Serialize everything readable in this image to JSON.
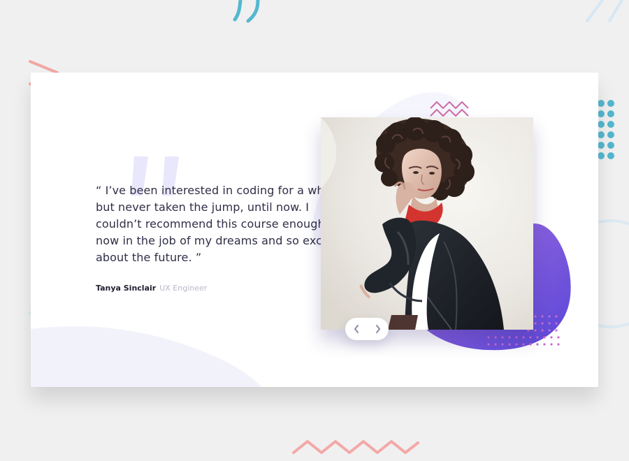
{
  "testimonial": {
    "quote": "“ I’ve been interested in coding for a while but never taken the jump, until now. I couldn’t recommend this course enough. I’m now in the job of my dreams and so excited about the future. ”",
    "author_name": "Tanya Sinclair",
    "author_role": "UX Engineer"
  },
  "navigation": {
    "previous_icon": "chevron-left-icon",
    "next_icon": "chevron-right-icon"
  },
  "colors": {
    "background": "#f0f0f0",
    "card": "#ffffff",
    "text": "#2f2f47",
    "muted": "#b8b8c8",
    "purple_start": "#9d6bdc",
    "purple_end": "#5a45d8",
    "teal": "#4ba9c8",
    "pink": "#f4a6a6"
  }
}
